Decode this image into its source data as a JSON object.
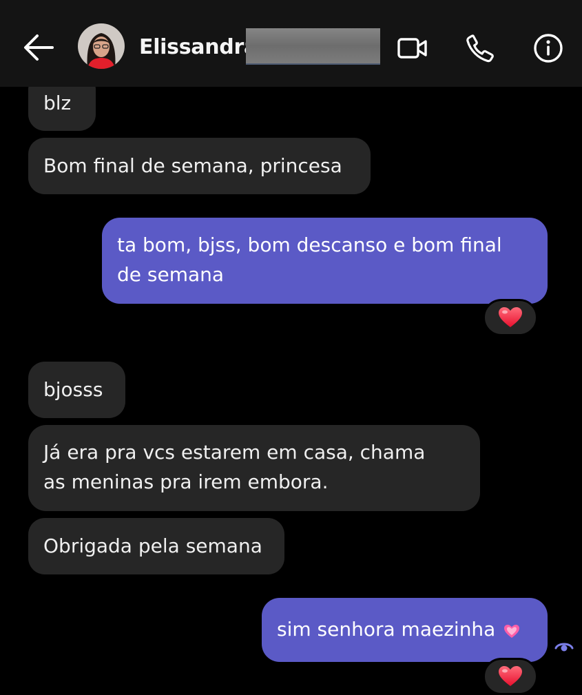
{
  "header": {
    "contact_name": "Elissandra"
  },
  "messages": [
    {
      "text": "blz",
      "direction": "incoming"
    },
    {
      "text": "Bom final de semana, princesa",
      "direction": "incoming"
    },
    {
      "lines": [
        "ta bom, bjss, bom descanso e bom final",
        "de semana"
      ],
      "direction": "outgoing",
      "reaction": "heart-emoji"
    },
    {
      "text": "bjosss",
      "direction": "incoming"
    },
    {
      "lines": [
        "Já era pra vcs estarem em casa, chama",
        "as meninas pra irem embora."
      ],
      "direction": "incoming"
    },
    {
      "text": "Obrigada pela semana",
      "direction": "incoming"
    },
    {
      "text": "sim senhora maezinha",
      "direction": "outgoing",
      "inline_emoji": "sparkling-heart-emoji",
      "reaction": "heart-emoji"
    }
  ],
  "icons": {
    "back": "arrow-left-icon",
    "video": "video-camera-icon",
    "call": "phone-icon",
    "info": "info-icon",
    "seen": "seen-eye-icon"
  },
  "colors": {
    "header_bg": "#141414",
    "incoming_bubble": "#262626",
    "outgoing_bubble": "#5b5ac6",
    "background": "#000000",
    "heart": "#ff2d55"
  }
}
